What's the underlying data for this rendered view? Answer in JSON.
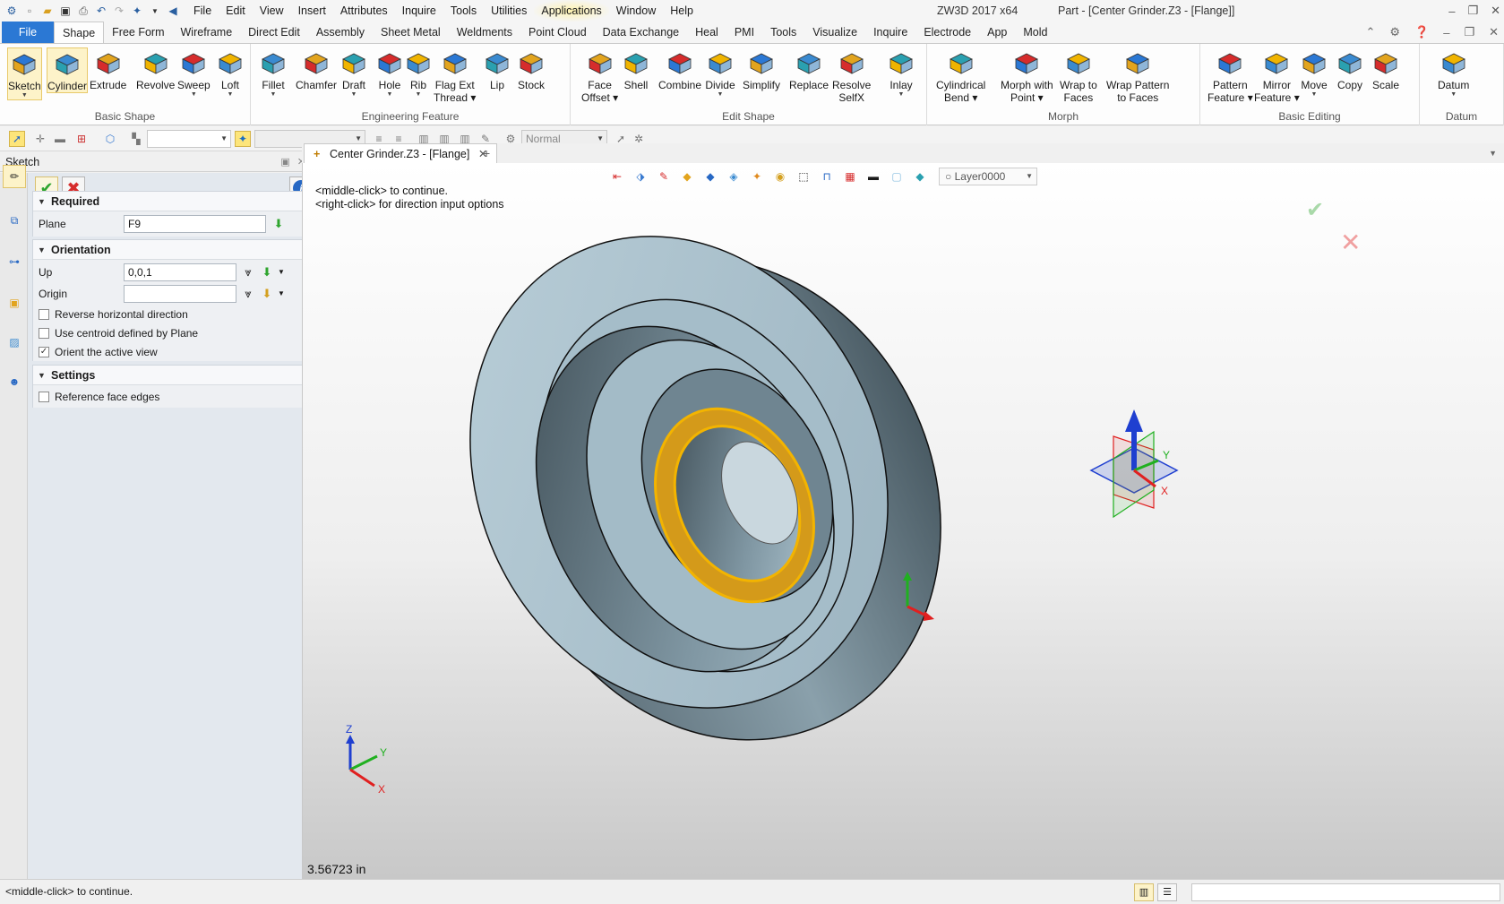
{
  "app": {
    "app_title": "ZW3D 2017  x64",
    "doc_title": "Part - [Center Grinder.Z3 - [Flange]]"
  },
  "menu": [
    "File",
    "Edit",
    "View",
    "Insert",
    "Attributes",
    "Inquire",
    "Tools",
    "Utilities",
    "Applications",
    "Window",
    "Help"
  ],
  "tabs": [
    "File",
    "Shape",
    "Free Form",
    "Wireframe",
    "Direct Edit",
    "Assembly",
    "Sheet Metal",
    "Weldments",
    "Point Cloud",
    "Data Exchange",
    "Heal",
    "PMI",
    "Tools",
    "Visualize",
    "Inquire",
    "Electrode",
    "App",
    "Mold"
  ],
  "active_tab": "Shape",
  "ribbon": {
    "groups": [
      {
        "label": "Basic Shape",
        "buttons": [
          {
            "line1": "Sketch",
            "line2": "",
            "dd": true,
            "icon": "sketch-icon"
          },
          {
            "line1": "Cylinder",
            "line2": "",
            "dd": false,
            "icon": "cylinder-icon"
          },
          {
            "line1": "Extrude",
            "line2": "",
            "dd": false,
            "icon": "extrude-icon"
          },
          {
            "line1": "Revolve",
            "line2": "",
            "dd": false,
            "icon": "revolve-icon"
          },
          {
            "line1": "Sweep",
            "line2": "",
            "dd": true,
            "icon": "sweep-icon"
          },
          {
            "line1": "Loft",
            "line2": "",
            "dd": true,
            "icon": "loft-icon"
          }
        ]
      },
      {
        "label": "Engineering Feature",
        "buttons": [
          {
            "line1": "Fillet",
            "line2": "",
            "dd": true,
            "icon": "fillet-icon"
          },
          {
            "line1": "Chamfer",
            "line2": "",
            "dd": false,
            "icon": "chamfer-icon"
          },
          {
            "line1": "Draft",
            "line2": "",
            "dd": true,
            "icon": "draft-icon"
          },
          {
            "line1": "Hole",
            "line2": "",
            "dd": true,
            "icon": "hole-icon"
          },
          {
            "line1": "Rib",
            "line2": "",
            "dd": true,
            "icon": "rib-icon"
          },
          {
            "line1": "Flag Ext",
            "line2": "Thread",
            "dd": true,
            "icon": "flag-ext-thread-icon"
          },
          {
            "line1": "Lip",
            "line2": "",
            "dd": false,
            "icon": "lip-icon"
          },
          {
            "line1": "Stock",
            "line2": "",
            "dd": false,
            "icon": "stock-icon"
          }
        ]
      },
      {
        "label": "Edit Shape",
        "buttons": [
          {
            "line1": "Face",
            "line2": "Offset",
            "dd": true,
            "icon": "face-offset-icon"
          },
          {
            "line1": "Shell",
            "line2": "",
            "dd": false,
            "icon": "shell-icon"
          },
          {
            "line1": "Combine",
            "line2": "",
            "dd": false,
            "icon": "combine-icon"
          },
          {
            "line1": "Divide",
            "line2": "",
            "dd": true,
            "icon": "divide-icon"
          },
          {
            "line1": "Simplify",
            "line2": "",
            "dd": false,
            "icon": "simplify-icon"
          },
          {
            "line1": "Replace",
            "line2": "",
            "dd": false,
            "icon": "replace-icon"
          },
          {
            "line1": "Resolve",
            "line2": "SelfX",
            "dd": false,
            "icon": "resolve-selfx-icon"
          },
          {
            "line1": "Inlay",
            "line2": "",
            "dd": true,
            "icon": "inlay-icon"
          }
        ]
      },
      {
        "label": "Morph",
        "buttons": [
          {
            "line1": "Cylindrical",
            "line2": "Bend",
            "dd": true,
            "icon": "cylindrical-bend-icon"
          },
          {
            "line1": "Morph with",
            "line2": "Point",
            "dd": true,
            "icon": "morph-point-icon"
          },
          {
            "line1": "Wrap to",
            "line2": "Faces",
            "dd": false,
            "icon": "wrap-faces-icon"
          },
          {
            "line1": "Wrap Pattern",
            "line2": "to Faces",
            "dd": false,
            "icon": "wrap-pattern-icon"
          }
        ]
      },
      {
        "label": "Basic Editing",
        "buttons": [
          {
            "line1": "Pattern",
            "line2": "Feature",
            "dd": true,
            "icon": "pattern-feature-icon"
          },
          {
            "line1": "Mirror",
            "line2": "Feature",
            "dd": true,
            "icon": "mirror-feature-icon"
          },
          {
            "line1": "Move",
            "line2": "",
            "dd": true,
            "icon": "move-icon"
          },
          {
            "line1": "Copy",
            "line2": "",
            "dd": false,
            "icon": "copy-icon"
          },
          {
            "line1": "Scale",
            "line2": "",
            "dd": false,
            "icon": "scale-icon"
          }
        ]
      },
      {
        "label": "Datum",
        "buttons": [
          {
            "line1": "Datum",
            "line2": "",
            "dd": true,
            "icon": "datum-icon"
          }
        ]
      }
    ]
  },
  "toolbar2": {
    "style_combo": "Normal"
  },
  "left_panel": {
    "header": "Sketch",
    "required": {
      "title": "Required",
      "plane_label": "Plane",
      "plane_value": "F9"
    },
    "orientation": {
      "title": "Orientation",
      "up_label": "Up",
      "up_value": "0,0,1",
      "origin_label": "Origin",
      "origin_value": "",
      "checks": [
        {
          "label": "Reverse horizontal direction",
          "checked": false
        },
        {
          "label": "Use centroid defined by Plane",
          "checked": false
        },
        {
          "label": "Orient the active view",
          "checked": true
        }
      ]
    },
    "settings": {
      "title": "Settings",
      "checks": [
        {
          "label": "Reference face edges",
          "checked": false
        }
      ]
    }
  },
  "document": {
    "tab_label": "Center Grinder.Z3 - [Flange]"
  },
  "viewport": {
    "prompt_line1": "<middle-click> to continue.",
    "prompt_line2": "<right-click> for direction input options",
    "layer": "Layer0000",
    "measure": "3.56723 in",
    "axis_labels": {
      "x": "X",
      "y": "Y",
      "z": "Z"
    },
    "colors": {
      "part_face": "#a9c1cd",
      "selected_face": "#d49a1a",
      "selected_edge": "#f3b400",
      "axis_x": "#e02020",
      "axis_y": "#20b020",
      "axis_z": "#1f3fd0"
    }
  },
  "status": {
    "text": "<middle-click> to continue."
  }
}
